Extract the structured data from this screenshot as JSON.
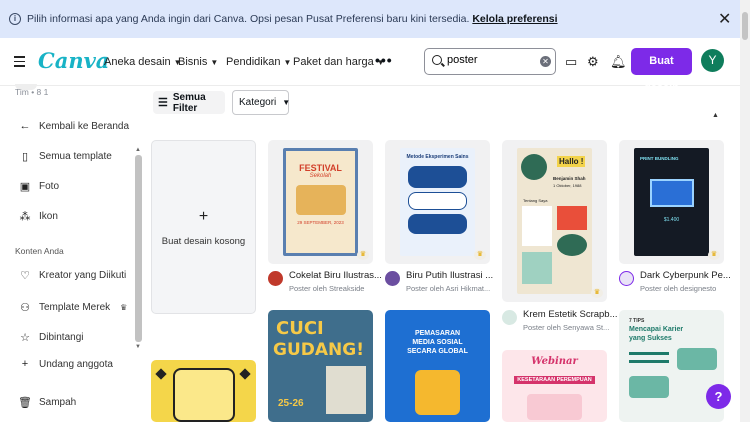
{
  "banner": {
    "message": "Pilih informasi apa yang Anda ingin dari Canva. Opsi pesan Pusat Preferensi baru kini tersedia.",
    "link": "Kelola preferensi",
    "info_icon": "info-icon",
    "close_icon": "close-icon"
  },
  "header": {
    "logo": "Canva",
    "nav": [
      "Aneka desain",
      "Bisnis",
      "Pendidikan",
      "Paket dan harga"
    ],
    "more": "•••",
    "search_value": "poster",
    "create_label": "Buat desain",
    "avatar_initial": "Y"
  },
  "sidebar": {
    "team_sub": "Tim • 8 1",
    "back": "Kembali ke Beranda",
    "items": [
      "Semua template",
      "Foto",
      "Ikon"
    ],
    "section_label": "Konten Anda",
    "content_items": [
      "Kreator yang Diikuti",
      "Template Merek",
      "Dibintangi",
      "Undang anggota",
      "Sampah"
    ]
  },
  "filters": {
    "all_filters": "Semua Filter",
    "category": "Kategori"
  },
  "empty_card": {
    "plus": "+",
    "label": "Buat desain kosong"
  },
  "cards": [
    {
      "title": "Cokelat Biru Ilustras...",
      "by": "Poster oleh Streakside",
      "thumb_title": "FESTIVAL",
      "thumb_sub": "Sekolah",
      "thumb_date": "29 SEPTEMBER, 2023"
    },
    {
      "title": "Biru Putih Ilustrasi ...",
      "by": "Poster oleh Asri Hikmat...",
      "thumb_title": "Metode Eksperimen Sains"
    },
    {
      "title": "Krem Estetik Scrapb...",
      "by": "Poster oleh Senyawa St...",
      "thumb_title": "Hallo !",
      "thumb_name": "Benjamin Shah",
      "thumb_date": "1 Oktober, 1988",
      "thumb_extra": "Tentang Saya"
    },
    {
      "title": "Dark Cyberpunk Pe...",
      "by": "Poster oleh designesto",
      "thumb_title": "PRINT BUNDLING",
      "thumb_price": "$1.400"
    }
  ],
  "bottom_cards": [
    {
      "line1": "CUCI",
      "line2": "GUDANG!",
      "date": "25-26"
    },
    {
      "line1": "PEMASARAN",
      "line2": "MEDIA SOSIAL",
      "line3": "SECARA GLOBAL"
    },
    {
      "line1": "Webinar",
      "line2": "KESETARAAN PEREMPUAN"
    },
    {
      "line1": "7 TIPS",
      "line2": "Mencapai Karier",
      "line3": "yang Sukses"
    }
  ],
  "help_label": "?",
  "colors": {
    "accent": "#7d2ae8",
    "banner_bg": "#dde7fb",
    "logo": "#18b3c6",
    "avatar": "#0f7d5c"
  }
}
